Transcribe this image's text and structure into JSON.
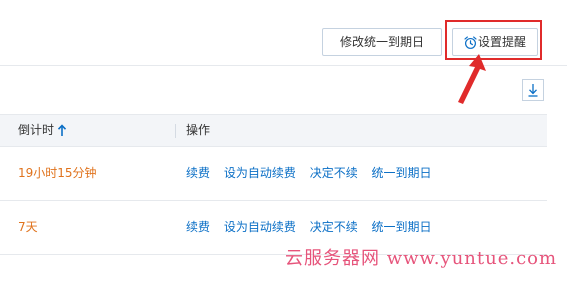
{
  "toolbar": {
    "modify_label": "修改统一到期日",
    "reminder_label": "设置提醒"
  },
  "table": {
    "columns": {
      "countdown": "倒计时",
      "operations": "操作"
    },
    "rows": [
      {
        "countdown": "19小时15分钟",
        "actions": [
          "续费",
          "设为自动续费",
          "决定不续",
          "统一到期日"
        ]
      },
      {
        "countdown": "7天",
        "actions": [
          "续费",
          "设为自动续费",
          "决定不续",
          "统一到期日"
        ]
      }
    ]
  },
  "watermark": "云服务器网 www.yuntue.com",
  "colors": {
    "link": "#0b6fc6",
    "countdown": "#e0731d",
    "annotation": "#e02b2b",
    "watermark": "#e4426d"
  },
  "icons": {
    "reminder": "alarm-clock-icon",
    "download": "download-icon",
    "sort": "sort-ascending-icon"
  }
}
